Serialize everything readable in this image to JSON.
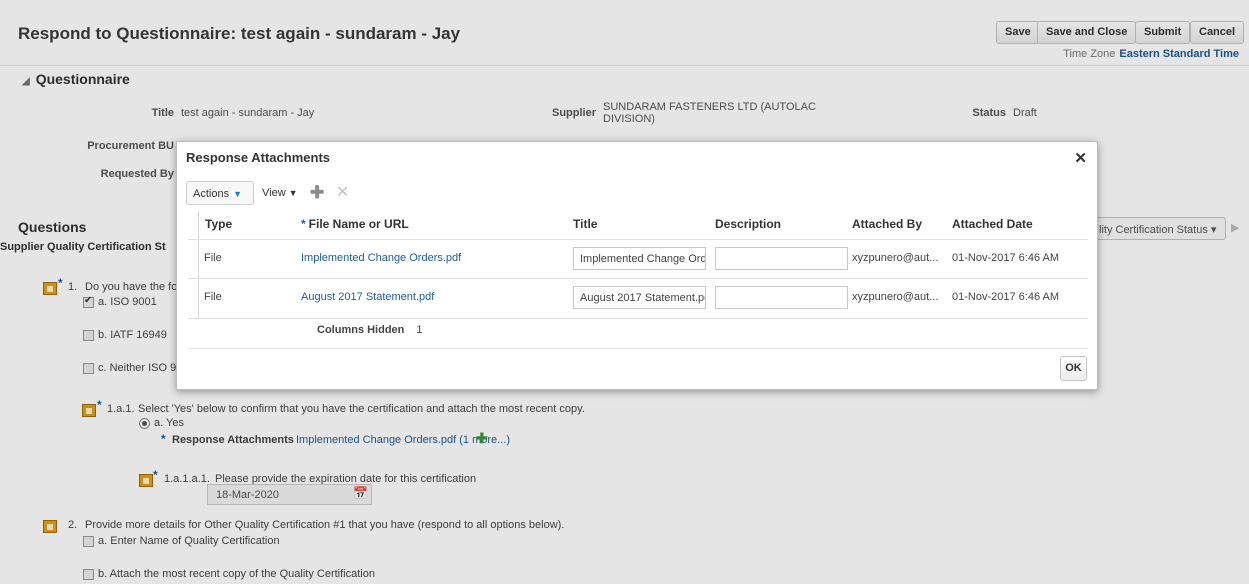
{
  "page": {
    "title": "Respond to Questionnaire: test again - sundaram - Jay",
    "buttons": {
      "save": "Save",
      "save_and_close": "Save and Close",
      "submit": "Submit",
      "cancel": "Cancel"
    },
    "time_zone_label": "Time Zone",
    "time_zone_value": "Eastern Standard Time"
  },
  "questionnaire": {
    "section_title": "Questionnaire",
    "title_label": "Title",
    "title_value": "test again - sundaram - Jay",
    "supplier_label": "Supplier",
    "supplier_value_line1": "SUNDARAM FASTENERS LTD (AUTOLAC",
    "supplier_value_line2": "DIVISION)",
    "status_label": "Status",
    "status_value": "Draft",
    "procurement_bu_label": "Procurement BU",
    "requested_by_label": "Requested By"
  },
  "questions": {
    "section_title": "Questions",
    "section_subtitle": "Supplier Quality Certification St",
    "filter_select": "lity Certification Status ▾",
    "q1_number": "1.",
    "q1_text": "Do you have the fol",
    "q1_option_a": "a. ISO 9001",
    "q1_option_b": "b. IATF 16949",
    "q1_option_c": "c. Neither ISO 9C",
    "q1a1_number": "1.a.1.",
    "q1a1_text": "Select 'Yes' below to confirm that you have the certification and attach the most recent copy.",
    "q1a1_option_a": "a. Yes",
    "response_attachments_label": "Response Attachments",
    "response_attachments_value": "Implemented Change Orders.pdf (1 more...)",
    "q1a1a1_number": "1.a.1.a.1.",
    "q1a1a1_text": "Please provide the expiration date for this certification",
    "q1a1a1_date": "18-Mar-2020",
    "q2_number": "2.",
    "q2_text": "Provide more details for Other Quality Certification #1 that you have (respond to all options below).",
    "q2_option_a": "a. Enter Name of Quality Certification",
    "q2_option_b": "b. Attach the most recent copy of the Quality Certification"
  },
  "dialog": {
    "title": "Response Attachments",
    "toolbar": {
      "actions": "Actions",
      "view": "View"
    },
    "columns": {
      "type": "Type",
      "file_name": "File Name or URL",
      "title": "Title",
      "description": "Description",
      "attached_by": "Attached By",
      "attached_date": "Attached Date"
    },
    "rows": [
      {
        "type": "File",
        "file_name": "Implemented Change Orders.pdf",
        "title": "Implemented Change Ord",
        "description": "",
        "attached_by": "xyzpunero@aut...",
        "attached_date": "01-Nov-2017 6:46 AM"
      },
      {
        "type": "File",
        "file_name": "August 2017 Statement.pdf",
        "title": "August 2017 Statement.pc",
        "description": "",
        "attached_by": "xyzpunero@aut...",
        "attached_date": "01-Nov-2017 6:46 AM"
      }
    ],
    "columns_hidden_label": "Columns Hidden",
    "columns_hidden_count": "1",
    "ok": "OK"
  }
}
